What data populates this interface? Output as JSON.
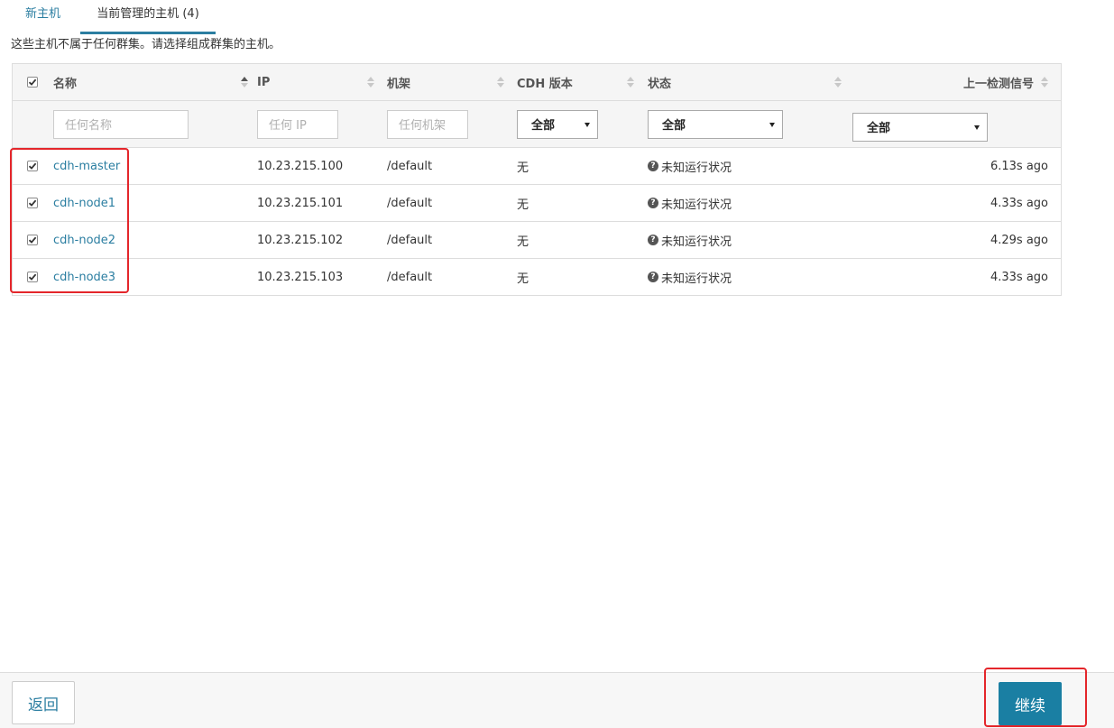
{
  "tabs": {
    "new_hosts": "新主机",
    "current_managed": "当前管理的主机 (4)"
  },
  "description": "这些主机不属于任何群集。请选择组成群集的主机。",
  "table": {
    "headers": {
      "name": "名称",
      "ip": "IP",
      "rack": "机架",
      "cdh_version": "CDH 版本",
      "state": "状态",
      "last_heartbeat": "上一检测信号"
    },
    "filters": {
      "name_placeholder": "任何名称",
      "ip_placeholder": "任何 IP",
      "rack_placeholder": "任何机架",
      "cdh_select": "全部",
      "state_select": "全部",
      "heartbeat_select": "全部"
    },
    "rows": [
      {
        "name": "cdh-master",
        "ip": "10.23.215.100",
        "rack": "/default",
        "cdh": "无",
        "state": "未知运行状况",
        "heartbeat": "6.13s ago",
        "checked": true
      },
      {
        "name": "cdh-node1",
        "ip": "10.23.215.101",
        "rack": "/default",
        "cdh": "无",
        "state": "未知运行状况",
        "heartbeat": "4.33s ago",
        "checked": true
      },
      {
        "name": "cdh-node2",
        "ip": "10.23.215.102",
        "rack": "/default",
        "cdh": "无",
        "state": "未知运行状况",
        "heartbeat": "4.29s ago",
        "checked": true
      },
      {
        "name": "cdh-node3",
        "ip": "10.23.215.103",
        "rack": "/default",
        "cdh": "无",
        "state": "未知运行状况",
        "heartbeat": "4.33s ago",
        "checked": true
      }
    ]
  },
  "footer": {
    "back_label": "返回",
    "continue_label": "继续"
  },
  "icons": {
    "checkbox": "check-icon",
    "state": "question-circle-icon",
    "sort": "sort-icon",
    "select": "caret-down-icon"
  },
  "colors": {
    "accent": "#2b7ea1",
    "primary_button": "#1a7fa3",
    "highlight": "#e4262b"
  }
}
